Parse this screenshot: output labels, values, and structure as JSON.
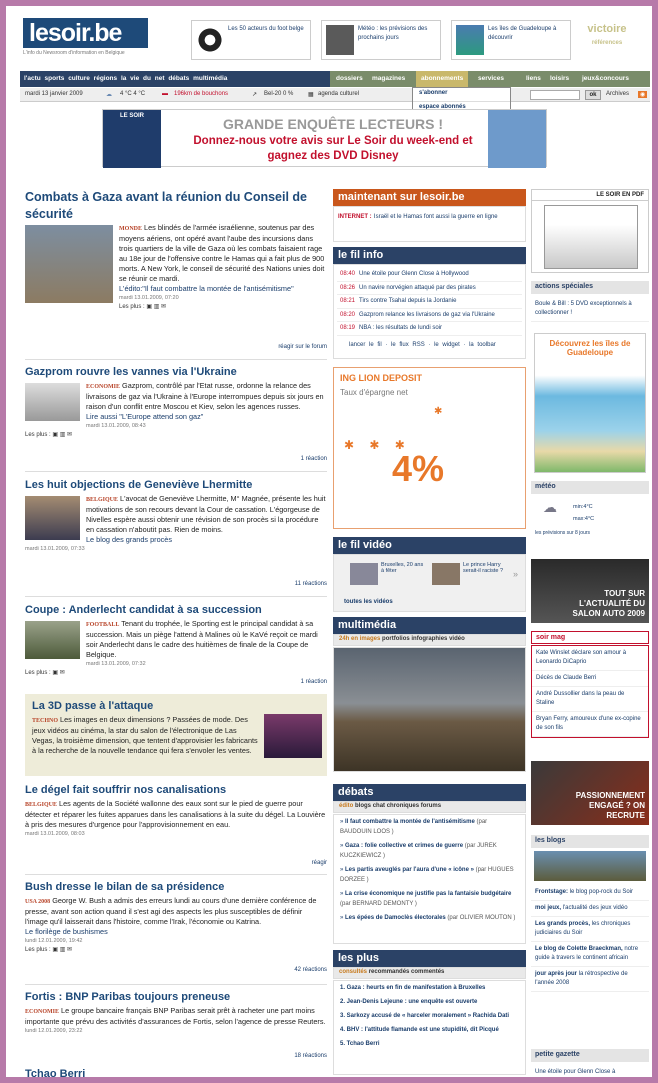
{
  "logo": {
    "name": "lesoir.be",
    "tagline": "L'info du Newsroom d'information en Belgique"
  },
  "teasers": [
    {
      "text": "Les 50 acteurs du foot belge"
    },
    {
      "text": "Météo : les prévisions des prochains jours"
    },
    {
      "text": "Les îles de Guadeloupe à découvrir"
    }
  ],
  "victoire": {
    "title": "victoire",
    "sub": "références"
  },
  "nav": {
    "left": "l'actu  sports  culture  régions  la vie du net  débats  multimédia",
    "right": [
      "dossiers",
      "magazines",
      "abonnements",
      "services",
      "liens",
      "loisirs",
      "jeux&concours"
    ]
  },
  "dropdown": [
    "s'abonner",
    "espace abonnés"
  ],
  "infobar": {
    "date": "mardi 13 janvier 2009",
    "temp": "4 °C 4 °C",
    "traffic": "196km de bouchons",
    "bel20": "Bel-20 0 %",
    "agenda": "agenda culturel",
    "ok": "ok",
    "archives": "Archives"
  },
  "banner": {
    "left": "LE SOIR",
    "line1": "GRANDE ENQUÊTE LECTEURS !",
    "line2": "Donnez-nous votre avis sur Le Soir du week-end et gagnez des DVD Disney"
  },
  "articles": [
    {
      "title": "Combats à Gaza avant la réunion du Conseil de sécurité",
      "rub": "MONDE",
      "text": "Les blindés de l'armée israélienne, soutenus par des moyens aériens, ont opéré avant l'aube des incursions dans trois quartiers de la ville de Gaza où les combats faisaient rage au 18e jour de l'offensive contre le Hamas qui a fait plus de 900 morts. A New York, le conseil de sécurité des Nations unies doit se réunir ce mardi.",
      "extra": "L'édito:\"Il faut combattre la montée de l'antisémitisme\"",
      "date": "mardi 13.01.2009, 07:20",
      "plus": "Les plus :",
      "react": "réagir sur le forum"
    },
    {
      "title": "Gazprom rouvre les vannes via l'Ukraine",
      "rub": "ECONOMIE",
      "text": "Gazprom, contrôlé par l'Etat russe, ordonne la relance des livraisons de gaz via l'Ukraine à l'Europe interrompues depuis six jours en raison d'un conflit entre Moscou et Kiev, selon les agences russes.",
      "extra": "Lire aussi \"L'Europe attend son gaz\"",
      "date": "mardi 13.01.2009, 08:43",
      "plus": "Les plus :",
      "react": "1 réaction"
    },
    {
      "title": "Les huit objections de Geneviève Lhermitte",
      "rub": "BELGIQUE",
      "text": "L'avocat de Geneviève Lhermitte, M° Magnée, présente les huit motivations de son recours devant la Cour de cassation. L'égorgeuse de Nivelles espère aussi obtenir une révision de son procès si la procédure en cassation n'aboutit pas. Rien de moins.",
      "extra": "Le blog des grands procès",
      "date": "mardi 13.01.2009, 07:33",
      "react": "11 réactions"
    },
    {
      "title": "Coupe : Anderlecht candidat à sa succession",
      "rub": "FOOTBALL",
      "text": "Tenant du trophée, le Sporting est le principal candidat à sa succession. Mais un piège l'attend à Malines où le KaVé reçoit ce mardi soir Anderlecht dans le cadre des huitièmes de finale de la Coupe de Belgique.",
      "date": "mardi 13.01.2009, 07:32",
      "plus": "Les plus :",
      "react": "1 réaction"
    },
    {
      "title": "La 3D passe à l'attaque",
      "rub": "TECHNO",
      "text": "Les images en deux dimensions ? Passées de mode. Des jeux vidéos au cinéma, la star du salon de l'électronique de Las Vegas, la troisième dimension, que tentent d'approvisier les fabricants à la recherche de la nouvelle tendance qui fera s'envoler les ventes."
    },
    {
      "title": "Le dégel fait souffrir nos canalisations",
      "rub": "BELGIQUE",
      "text": "Les agents de la Société wallonne des eaux sont sur le pied de guerre pour détecter et réparer les fuites apparues dans les canalisations à la suite du dégel. La Louvière à pris des mesures d'urgence pour l'approvisionnement en eau.",
      "date": "mardi 13.01.2009, 08:03",
      "react": "réagir"
    },
    {
      "title": "Bush dresse le bilan de sa présidence",
      "rub": "USA 2008",
      "text": "George W. Bush a admis des erreurs lundi au cours d'une dernière conférence de presse, avant son action quand il s'est agi des aspects les plus susceptibles de définir l'image qu'il laisserait dans l'histoire, comme l'Irak, l'économie ou Katrina.",
      "extra": "Le florilège de bushismes",
      "date": "lundi 12.01.2009, 19:42",
      "plus": "Les plus :",
      "react": "42 réactions"
    },
    {
      "title": "Fortis : BNP Paribas toujours preneuse",
      "rub": "ECONOMIE",
      "text": "Le groupe bancaire français BNP Paribas serait prêt à racheter une part moins importante que prévu des activités d'assurances de Fortis, selon l'agence de presse Reuters.",
      "date": "lundi 12.01.2009, 23:22",
      "react": "18 réactions"
    },
    {
      "title": "Tchao Berri"
    }
  ],
  "center": {
    "maintenant": {
      "title": "maintenant sur lesoir.be",
      "label": "INTERNET :",
      "text": "Israël et le Hamas font aussi la guerre en ligne"
    },
    "filinfo": {
      "title": "le fil info",
      "items": [
        {
          "t": "08:40",
          "x": "Une étoile pour Glenn Close à Hollywood"
        },
        {
          "t": "08:26",
          "x": "Un navire norvégien attaqué par des pirates"
        },
        {
          "t": "08:21",
          "x": "Tirs contre Tsahal depuis la Jordanie"
        },
        {
          "t": "08:20",
          "x": "Gazprom relance les livraisons de gaz via l'Ukraine"
        },
        {
          "t": "08:19",
          "x": "NBA : les résultats de lundi soir"
        }
      ],
      "links": [
        "lancer le fil",
        "le flux RSS",
        "le widget",
        "la toolbar"
      ]
    },
    "ad": {
      "title": "ING LION DEPOSIT",
      "sub": "Taux d'épargne net",
      "rate": "4%"
    },
    "filvideo": {
      "title": "le fil vidéo",
      "v1": "Bruxelles, 20 ans à fêter",
      "v2": "Le prince Harry serait-il raciste ?",
      "more": "toutes les vidéos"
    },
    "multimedia": {
      "title": "multimédia",
      "tabs": [
        "24h en images",
        "portfolios",
        "infographies",
        "vidéo"
      ]
    },
    "debats": {
      "title": "débats",
      "tabs": [
        "édito",
        "blogs",
        "chat",
        "chroniques",
        "forums"
      ],
      "items": [
        {
          "b": "Il faut combattre la montée de l'antisémitisme",
          "a": "(par BAUDOUIN LOOS )"
        },
        {
          "b": "Gaza : folie collective et crimes de guerre",
          "a": "(par JUREK KUCZKIEWICZ )"
        },
        {
          "b": "Les partis aveuglés par l'aura d'une « icône »",
          "a": "(par HUGUES DORZEE )"
        },
        {
          "b": "La crise économique ne justifie pas la fantaisie budgétaire",
          "a": "(par BERNARD DEMONTY )"
        },
        {
          "b": "Les épées de Damoclès électorales",
          "a": "(par OLIVIER MOUTON )"
        }
      ]
    },
    "lesplus": {
      "title": "les plus",
      "tabs": [
        "consultés",
        "recommandés",
        "commentés"
      ],
      "items": [
        "1.  Gaza : heurts en fin de manifestation à Bruxelles",
        "2.  Jean-Denis Lejeune : une enquête est ouverte",
        "3.  Sarkozy accusé de « harceler moralement » Rachida Dati",
        "4.  BHV : l'attitude flamande est une stupidité, dit Picqué",
        "5.  Tchao Berri"
      ]
    }
  },
  "right": {
    "pdf": "LE SOIR EN PDF",
    "actions": {
      "title": "actions spéciales",
      "text": "Boule & Bill : 5 DVD exceptionnels à collectionner !"
    },
    "guadeloupe": "Découvrez les îles de Guadeloupe",
    "meteo": {
      "title": "météo",
      "min": "min:4°C",
      "max": "max:4°C",
      "link": "les prévisions sur 8 jours"
    },
    "salon": "TOUT SUR L'ACTUALITÉ DU SALON AUTO 2009",
    "soirmag": {
      "title": "soir mag",
      "items": [
        "Kate Winslet déclare son amour à Leonardo DiCaprio",
        "Décès de Claude Berri",
        "André Dussollier dans la peau de Staline",
        "Bryan Ferry, amoureux d'une ex-copine de son fils"
      ]
    },
    "passion": "PASSIONNEMENT ENGAGÉ ? ON RECRUTE",
    "blogs": {
      "title": "les blogs",
      "items": [
        {
          "b": "Frontstage:",
          "x": "le blog pop-rock du Soir"
        },
        {
          "b": "moi jeux,",
          "x": "l'actualité des jeux vidéo"
        },
        {
          "b": "Les grands procès,",
          "x": "les chroniques judiciaires du Soir"
        },
        {
          "b": "Le blog de Colette Braeckman,",
          "x": "notre guide à travers le continent africain"
        },
        {
          "b": "jour après jour",
          "x": "la rétrospective de l'année 2008"
        }
      ]
    },
    "gazette": {
      "title": "petite gazette",
      "text": "Une étoile pour Glenn Close à"
    }
  },
  "colors": {
    "navy": "#2b4266",
    "red": "#c2102d",
    "orange": "#e8782a"
  }
}
